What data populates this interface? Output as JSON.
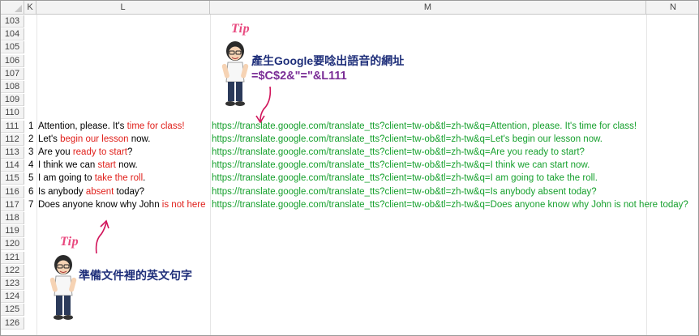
{
  "columns": {
    "k": "K",
    "l": "L",
    "m": "M",
    "n": "N"
  },
  "rows": [
    "103",
    "104",
    "105",
    "106",
    "107",
    "108",
    "109",
    "110",
    "111",
    "112",
    "113",
    "114",
    "115",
    "116",
    "117",
    "118",
    "119",
    "120",
    "121",
    "122",
    "123",
    "124",
    "125",
    "126"
  ],
  "sentences": [
    {
      "num": "1",
      "pre": "Attention, please. It's ",
      "hl": "time for class!",
      "post": "",
      "url": "https://translate.google.com/translate_tts?client=tw-ob&tl=zh-tw&q=Attention, please. It's time for class!"
    },
    {
      "num": "2",
      "pre": "Let's ",
      "hl": "begin our lesson",
      "post": " now.",
      "url": "https://translate.google.com/translate_tts?client=tw-ob&tl=zh-tw&q=Let's begin our lesson now."
    },
    {
      "num": "3",
      "pre": "Are you ",
      "hl": "ready to start",
      "post": "?",
      "url": "https://translate.google.com/translate_tts?client=tw-ob&tl=zh-tw&q=Are you ready to start?"
    },
    {
      "num": "4",
      "pre": "I think we can ",
      "hl": "start",
      "post": " now.",
      "url": "https://translate.google.com/translate_tts?client=tw-ob&tl=zh-tw&q=I think we can start now."
    },
    {
      "num": "5",
      "pre": "I am going to ",
      "hl": "take the roll",
      "post": ".",
      "url": "https://translate.google.com/translate_tts?client=tw-ob&tl=zh-tw&q=I am going to take the roll."
    },
    {
      "num": "6",
      "pre": "Is anybody ",
      "hl": "absent",
      "post": " today?",
      "url": "https://translate.google.com/translate_tts?client=tw-ob&tl=zh-tw&q=Is anybody absent today?"
    },
    {
      "num": "7",
      "pre": "Does anyone know why John ",
      "hl": "is not here",
      "post": " t",
      "url": "https://translate.google.com/translate_tts?client=tw-ob&tl=zh-tw&q=Does anyone know why John is not here today?"
    }
  ],
  "tips": {
    "top": {
      "label": "Tip",
      "note": "產生Google要唸出語音的網址",
      "formula": "=$C$2&\"=\"&L111"
    },
    "bottom": {
      "label": "Tip",
      "note": "準備文件裡的英文句字"
    }
  },
  "colors": {
    "highlight": "#e0201b",
    "url": "#16a02d",
    "tip": "#e8487e",
    "note": "#1f2f7a",
    "formula": "#7a2d96"
  }
}
